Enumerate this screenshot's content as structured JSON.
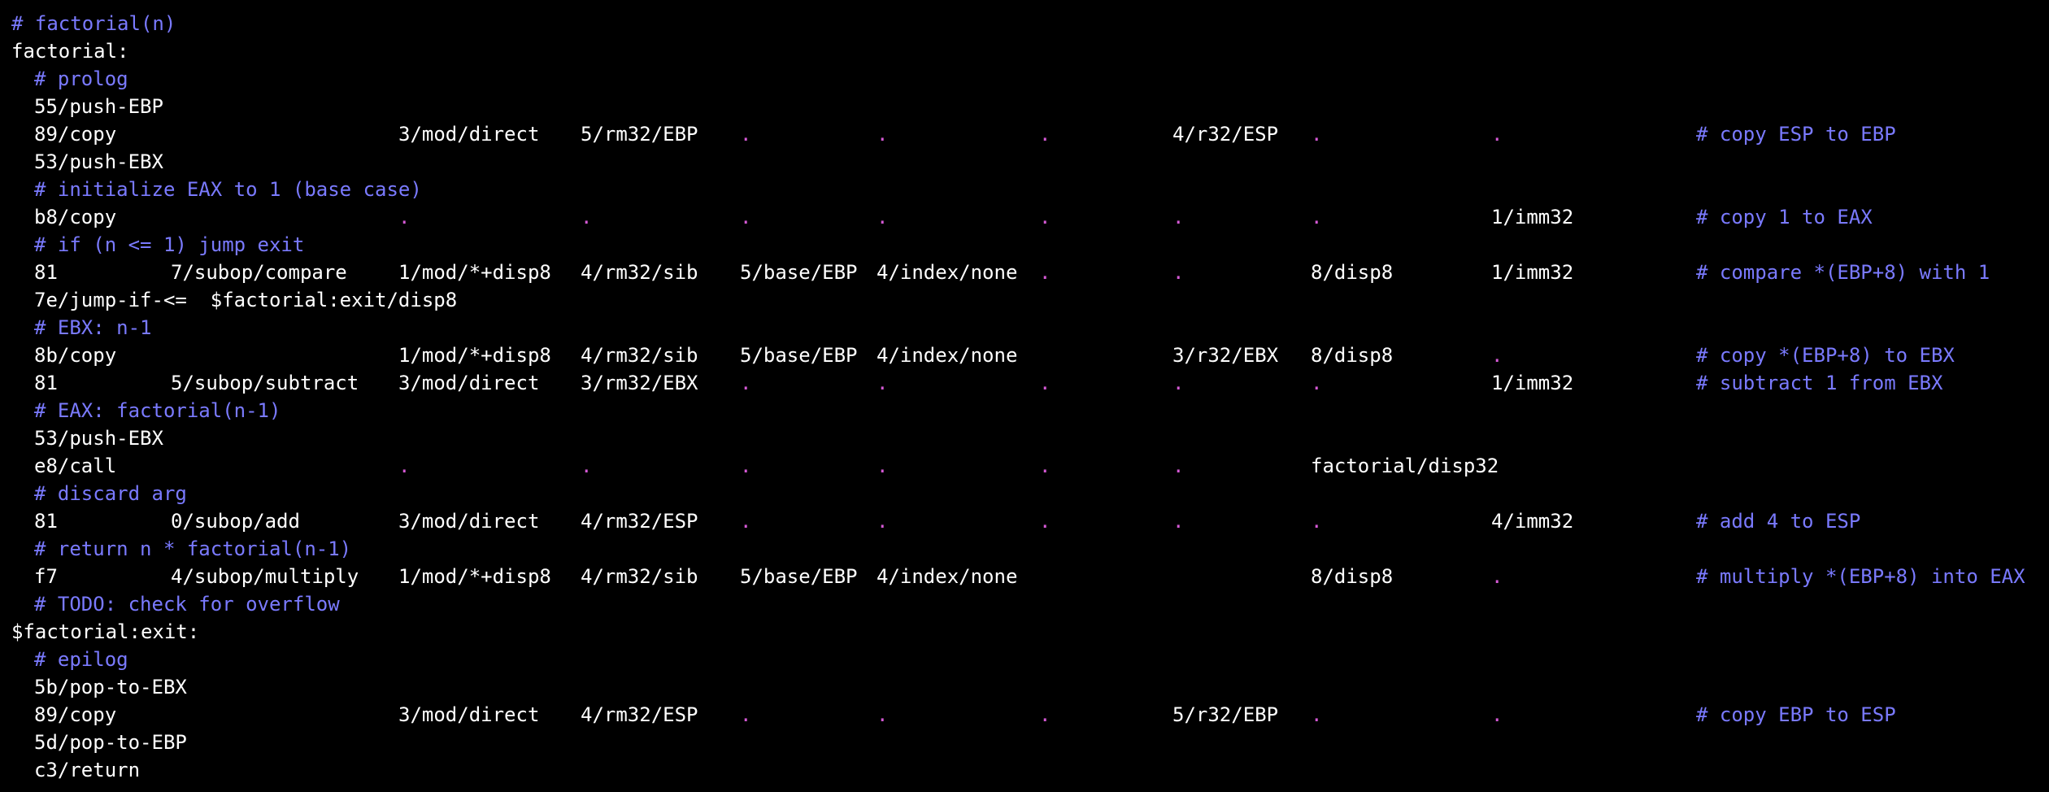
{
  "theme": {
    "background": "#000000",
    "code_color": "#ffffff",
    "comment_color": "#7a7aff",
    "dot_color": "#d65ad6"
  },
  "lines": [
    [
      {
        "t": "# factorial(n)",
        "k": "comment",
        "c": 0
      }
    ],
    [
      {
        "t": "factorial:",
        "k": "code",
        "c": 0
      }
    ],
    [
      {
        "t": "# prolog",
        "k": "comment",
        "c": 1
      }
    ],
    [
      {
        "t": "55/push-EBP",
        "k": "code",
        "c": 1
      }
    ],
    [
      {
        "t": "89/copy",
        "k": "code",
        "c": 1
      },
      {
        "t": "3/mod/direct",
        "k": "code",
        "c": 3
      },
      {
        "t": "5/rm32/EBP",
        "k": "code",
        "c": 4
      },
      {
        "t": ".",
        "k": "dot",
        "c": 5
      },
      {
        "t": ".",
        "k": "dot",
        "c": 6
      },
      {
        "t": ".",
        "k": "dot",
        "c": 7
      },
      {
        "t": "4/r32/ESP",
        "k": "code",
        "c": 8
      },
      {
        "t": ".",
        "k": "dot",
        "c": 9
      },
      {
        "t": ".",
        "k": "dot",
        "c": 10
      },
      {
        "t": "# copy ESP to EBP",
        "k": "comment",
        "c": 11
      }
    ],
    [
      {
        "t": "53/push-EBX",
        "k": "code",
        "c": 1
      }
    ],
    [
      {
        "t": "# initialize EAX to 1 (base case)",
        "k": "comment",
        "c": 1
      }
    ],
    [
      {
        "t": "b8/copy",
        "k": "code",
        "c": 1
      },
      {
        "t": ".",
        "k": "dot",
        "c": 3
      },
      {
        "t": ".",
        "k": "dot",
        "c": 4
      },
      {
        "t": ".",
        "k": "dot",
        "c": 5
      },
      {
        "t": ".",
        "k": "dot",
        "c": 6
      },
      {
        "t": ".",
        "k": "dot",
        "c": 7
      },
      {
        "t": ".",
        "k": "dot",
        "c": 8
      },
      {
        "t": ".",
        "k": "dot",
        "c": 9
      },
      {
        "t": "1/imm32",
        "k": "code",
        "c": 10
      },
      {
        "t": "# copy 1 to EAX",
        "k": "comment",
        "c": 11
      }
    ],
    [
      {
        "t": "# if (n <= 1) jump exit",
        "k": "comment",
        "c": 1
      }
    ],
    [
      {
        "t": "81",
        "k": "code",
        "c": 1
      },
      {
        "t": "7/subop/compare",
        "k": "code",
        "c": 2
      },
      {
        "t": "1/mod/*+disp8",
        "k": "code",
        "c": 3
      },
      {
        "t": "4/rm32/sib",
        "k": "code",
        "c": 4
      },
      {
        "t": "5/base/EBP",
        "k": "code",
        "c": 5
      },
      {
        "t": "4/index/none",
        "k": "code",
        "c": 6
      },
      {
        "t": ".",
        "k": "dot",
        "c": 7
      },
      {
        "t": ".",
        "k": "dot",
        "c": 8
      },
      {
        "t": "8/disp8",
        "k": "code",
        "c": 9
      },
      {
        "t": "1/imm32",
        "k": "code",
        "c": 10
      },
      {
        "t": "# compare *(EBP+8) with 1",
        "k": "comment",
        "c": 11
      }
    ],
    [
      {
        "t": "7e/jump-if-<=  $factorial:exit/disp8",
        "k": "code",
        "c": 1
      }
    ],
    [
      {
        "t": "# EBX: n-1",
        "k": "comment",
        "c": 1
      }
    ],
    [
      {
        "t": "8b/copy",
        "k": "code",
        "c": 1
      },
      {
        "t": "1/mod/*+disp8",
        "k": "code",
        "c": 3
      },
      {
        "t": "4/rm32/sib",
        "k": "code",
        "c": 4
      },
      {
        "t": "5/base/EBP",
        "k": "code",
        "c": 5
      },
      {
        "t": "4/index/none",
        "k": "code",
        "c": 6
      },
      {
        "t": "3/r32/EBX",
        "k": "code",
        "c": 8
      },
      {
        "t": "8/disp8",
        "k": "code",
        "c": 9
      },
      {
        "t": ".",
        "k": "dot",
        "c": 10
      },
      {
        "t": "# copy *(EBP+8) to EBX",
        "k": "comment",
        "c": 11
      }
    ],
    [
      {
        "t": "81",
        "k": "code",
        "c": 1
      },
      {
        "t": "5/subop/subtract",
        "k": "code",
        "c": 2
      },
      {
        "t": "3/mod/direct",
        "k": "code",
        "c": 3
      },
      {
        "t": "3/rm32/EBX",
        "k": "code",
        "c": 4
      },
      {
        "t": ".",
        "k": "dot",
        "c": 5
      },
      {
        "t": ".",
        "k": "dot",
        "c": 6
      },
      {
        "t": ".",
        "k": "dot",
        "c": 7
      },
      {
        "t": ".",
        "k": "dot",
        "c": 8
      },
      {
        "t": ".",
        "k": "dot",
        "c": 9
      },
      {
        "t": "1/imm32",
        "k": "code",
        "c": 10
      },
      {
        "t": "# subtract 1 from EBX",
        "k": "comment",
        "c": 11
      }
    ],
    [
      {
        "t": "# EAX: factorial(n-1)",
        "k": "comment",
        "c": 1
      }
    ],
    [
      {
        "t": "53/push-EBX",
        "k": "code",
        "c": 1
      }
    ],
    [
      {
        "t": "e8/call",
        "k": "code",
        "c": 1
      },
      {
        "t": ".",
        "k": "dot",
        "c": 3
      },
      {
        "t": ".",
        "k": "dot",
        "c": 4
      },
      {
        "t": ".",
        "k": "dot",
        "c": 5
      },
      {
        "t": ".",
        "k": "dot",
        "c": 6
      },
      {
        "t": ".",
        "k": "dot",
        "c": 7
      },
      {
        "t": ".",
        "k": "dot",
        "c": 8
      },
      {
        "t": "factorial/disp32",
        "k": "code",
        "c": 9
      }
    ],
    [
      {
        "t": "# discard arg",
        "k": "comment",
        "c": 1
      }
    ],
    [
      {
        "t": "81",
        "k": "code",
        "c": 1
      },
      {
        "t": "0/subop/add",
        "k": "code",
        "c": 2
      },
      {
        "t": "3/mod/direct",
        "k": "code",
        "c": 3
      },
      {
        "t": "4/rm32/ESP",
        "k": "code",
        "c": 4
      },
      {
        "t": ".",
        "k": "dot",
        "c": 5
      },
      {
        "t": ".",
        "k": "dot",
        "c": 6
      },
      {
        "t": ".",
        "k": "dot",
        "c": 7
      },
      {
        "t": ".",
        "k": "dot",
        "c": 8
      },
      {
        "t": ".",
        "k": "dot",
        "c": 9
      },
      {
        "t": "4/imm32",
        "k": "code",
        "c": 10
      },
      {
        "t": "# add 4 to ESP",
        "k": "comment",
        "c": 11
      }
    ],
    [
      {
        "t": "# return n * factorial(n-1)",
        "k": "comment",
        "c": 1
      }
    ],
    [
      {
        "t": "f7",
        "k": "code",
        "c": 1
      },
      {
        "t": "4/subop/multiply",
        "k": "code",
        "c": 2
      },
      {
        "t": "1/mod/*+disp8",
        "k": "code",
        "c": 3
      },
      {
        "t": "4/rm32/sib",
        "k": "code",
        "c": 4
      },
      {
        "t": "5/base/EBP",
        "k": "code",
        "c": 5
      },
      {
        "t": "4/index/none",
        "k": "code",
        "c": 6
      },
      {
        "t": "8/disp8",
        "k": "code",
        "c": 9
      },
      {
        "t": ".",
        "k": "dot",
        "c": 10
      },
      {
        "t": "# multiply *(EBP+8) into EAX",
        "k": "comment",
        "c": 11
      }
    ],
    [
      {
        "t": "# TODO: check for overflow",
        "k": "comment",
        "c": 1
      }
    ],
    [
      {
        "t": "$factorial:exit:",
        "k": "code",
        "c": 0
      }
    ],
    [
      {
        "t": "# epilog",
        "k": "comment",
        "c": 1
      }
    ],
    [
      {
        "t": "5b/pop-to-EBX",
        "k": "code",
        "c": 1
      }
    ],
    [
      {
        "t": "89/copy",
        "k": "code",
        "c": 1
      },
      {
        "t": "3/mod/direct",
        "k": "code",
        "c": 3
      },
      {
        "t": "4/rm32/ESP",
        "k": "code",
        "c": 4
      },
      {
        "t": ".",
        "k": "dot",
        "c": 5
      },
      {
        "t": ".",
        "k": "dot",
        "c": 6
      },
      {
        "t": ".",
        "k": "dot",
        "c": 7
      },
      {
        "t": "5/r32/EBP",
        "k": "code",
        "c": 8
      },
      {
        "t": ".",
        "k": "dot",
        "c": 9
      },
      {
        "t": ".",
        "k": "dot",
        "c": 10
      },
      {
        "t": "# copy EBP to ESP",
        "k": "comment",
        "c": 11
      }
    ],
    [
      {
        "t": "5d/pop-to-EBP",
        "k": "code",
        "c": 1
      }
    ],
    [
      {
        "t": "c3/return",
        "k": "code",
        "c": 1
      }
    ]
  ]
}
